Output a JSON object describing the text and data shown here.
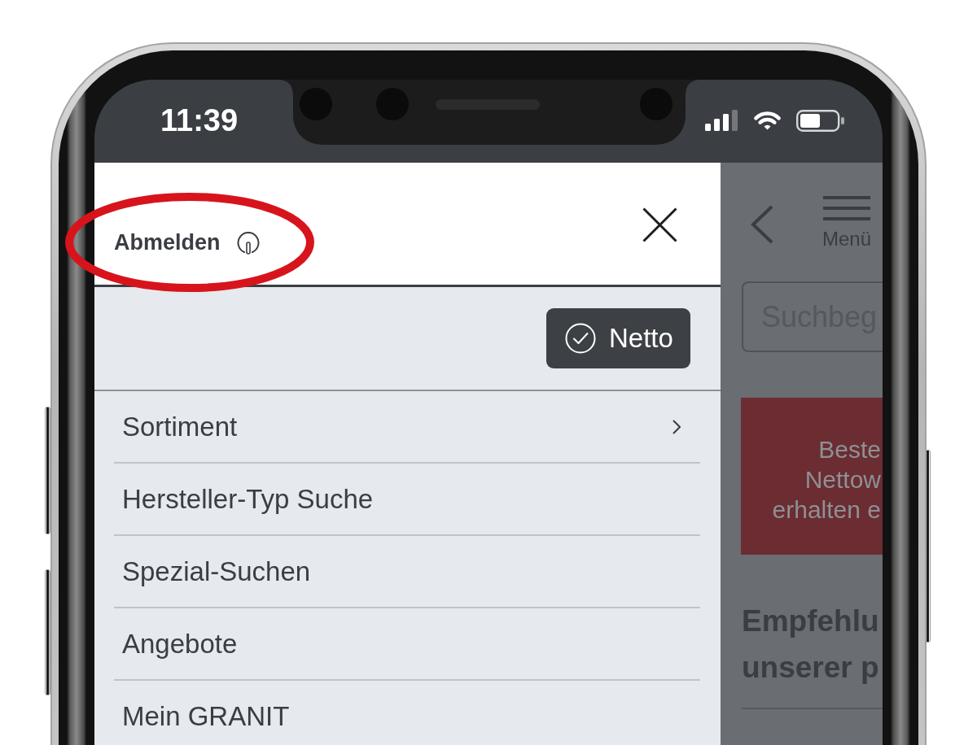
{
  "status_bar": {
    "time": "11:39"
  },
  "menu": {
    "logout": {
      "label": "Abmelden"
    },
    "netto_toggle": {
      "label": "Netto",
      "checked": true
    },
    "items": [
      {
        "label": "Sortiment",
        "has_submenu": true
      },
      {
        "label": "Hersteller-Typ Suche",
        "has_submenu": false
      },
      {
        "label": "Spezial-Suchen",
        "has_submenu": false
      },
      {
        "label": "Angebote",
        "has_submenu": false
      },
      {
        "label": "Mein GRANIT",
        "has_submenu": false
      }
    ]
  },
  "background_page": {
    "menu_button": {
      "label": "Menü"
    },
    "search": {
      "placeholder": "Suchbeg"
    },
    "banner": {
      "lines": [
        "Beste",
        "Nettow",
        "erhalten e"
      ]
    },
    "heading": {
      "lines": [
        "Empfehlu",
        "unserer p"
      ]
    }
  },
  "annotations": [
    {
      "kind": "ellipse"
    }
  ]
}
